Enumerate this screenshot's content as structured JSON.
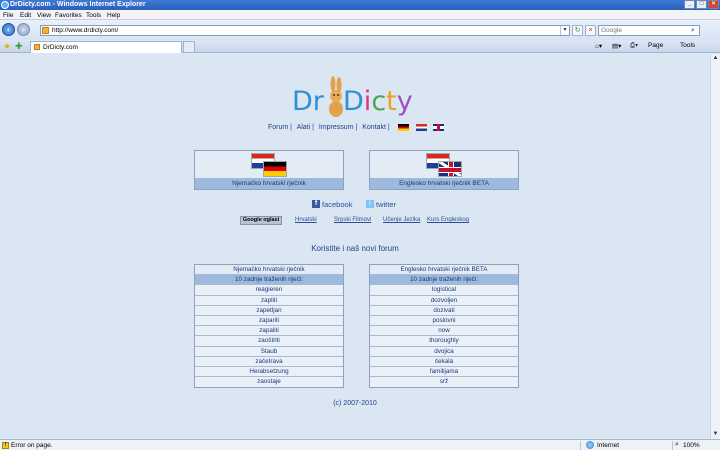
{
  "window": {
    "title": "DrDicty.com - Windows Internet Explorer"
  },
  "menu": [
    "File",
    "Edit",
    "View",
    "Favorites",
    "Tools",
    "Help"
  ],
  "address": {
    "url": "http://www.drdicty.com/"
  },
  "search": {
    "placeholder": "Google"
  },
  "tab": {
    "label": "DrDicty.com"
  },
  "commandbar": {
    "page": "Page",
    "tools": "Tools"
  },
  "logo": {
    "dr": "Dr",
    "dicty": [
      "D",
      "i",
      "c",
      "t",
      "y"
    ]
  },
  "toplinks": [
    "Forum |",
    "Alati |",
    "Impressum |",
    "Kontakt |"
  ],
  "dictionaries": [
    {
      "label": "Njemačko hrvatski rječnik"
    },
    {
      "label": "Englesko hrvatski rječnik BETA"
    }
  ],
  "social": {
    "facebook": "facebook",
    "twitter": "twitter"
  },
  "links": {
    "google": "Google oglasi",
    "items": [
      "Hrvatski",
      "Srpski Filmovi",
      "Učenje Jezika",
      "Kurs Engleskog"
    ]
  },
  "forum": {
    "title": "Koristite i naš novi forum"
  },
  "tables": [
    {
      "header": "Njemačko hrvatski rječnik",
      "subheader": "10 zadnje traženih riječi:",
      "rows": [
        "reagieren",
        "zapliti",
        "zapetljan",
        "zapariti",
        "zapaliti",
        "zaoštriti",
        "Staub",
        "začetrava",
        "Herabsetzung",
        "zaostaje"
      ]
    },
    {
      "header": "Englesko hrvatski rječnik BETA",
      "subheader": "10 zadnje traženih riječi:",
      "rows": [
        "logistical",
        "dozvoljen",
        "dozivati",
        "poslovni",
        "now",
        "thoroughly",
        "dvojica",
        "čekala",
        "familijama",
        "srž"
      ]
    }
  ],
  "footer": {
    "copyright": "(c) 2007-2010"
  },
  "status": {
    "message": "Error on page.",
    "zone": "Internet",
    "zoom": "100%"
  }
}
